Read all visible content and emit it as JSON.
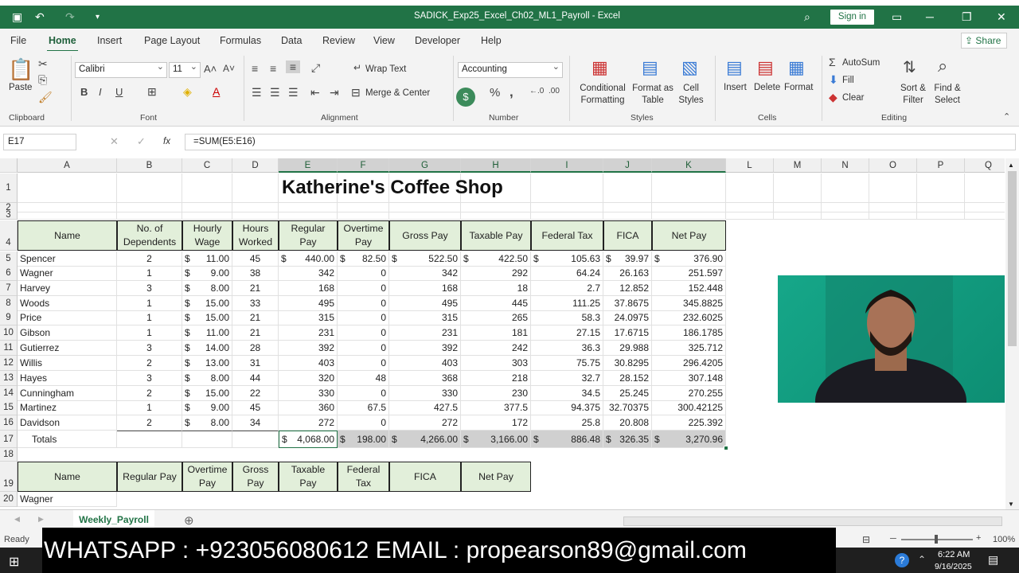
{
  "window": {
    "title": "SADICK_Exp25_Excel_Ch02_ML1_Payroll - Excel",
    "sign_in": "Sign in"
  },
  "menu": {
    "tabs": [
      "File",
      "Home",
      "Insert",
      "Page Layout",
      "Formulas",
      "Data",
      "Review",
      "View",
      "Developer",
      "Help"
    ],
    "share": "Share"
  },
  "ribbon": {
    "clipboard": {
      "paste": "Paste",
      "label": "Clipboard"
    },
    "font": {
      "name": "Calibri",
      "size": "11",
      "label": "Font"
    },
    "alignment": {
      "wrap": "Wrap Text",
      "merge": "Merge & Center",
      "label": "Alignment"
    },
    "number": {
      "format": "Accounting",
      "percent": "%",
      "comma": ",",
      "label": "Number"
    },
    "styles": {
      "cond": "Conditional Formatting",
      "table": "Format as Table",
      "cell": "Cell Styles",
      "label": "Styles"
    },
    "cells": {
      "insert": "Insert",
      "delete": "Delete",
      "format": "Format",
      "label": "Cells"
    },
    "editing": {
      "autosum": "AutoSum",
      "fill": "Fill",
      "clear": "Clear",
      "sort": "Sort & Filter",
      "find": "Find & Select",
      "label": "Editing"
    }
  },
  "formula_bar": {
    "name_box": "E17",
    "fx": "fx",
    "formula": "=SUM(E5:E16)"
  },
  "columns": [
    "A",
    "B",
    "C",
    "D",
    "E",
    "F",
    "G",
    "H",
    "I",
    "J",
    "K",
    "L",
    "M",
    "N",
    "O",
    "P",
    "Q"
  ],
  "rows": [
    "1",
    "2",
    "3",
    "4",
    "5",
    "6",
    "7",
    "8",
    "9",
    "10",
    "11",
    "12",
    "13",
    "14",
    "15",
    "16",
    "17",
    "18",
    "19",
    "20"
  ],
  "sheet_title": "Katherine's Coffee Shop",
  "headers": [
    "Name",
    "No. of Dependents",
    "Hourly Wage",
    "Hours Worked",
    "Regular Pay",
    "Overtime Pay",
    "Gross Pay",
    "Taxable Pay",
    "Federal Tax",
    "FICA",
    "Net Pay"
  ],
  "employees": [
    [
      "Spencer",
      "2",
      "11.00",
      "45",
      "440.00",
      "82.50",
      "522.50",
      "422.50",
      "105.63",
      "39.97",
      "376.90"
    ],
    [
      "Wagner",
      "1",
      "9.00",
      "38",
      "342",
      "0",
      "342",
      "292",
      "64.24",
      "26.163",
      "251.597"
    ],
    [
      "Harvey",
      "3",
      "8.00",
      "21",
      "168",
      "0",
      "168",
      "18",
      "2.7",
      "12.852",
      "152.448"
    ],
    [
      "Woods",
      "1",
      "15.00",
      "33",
      "495",
      "0",
      "495",
      "445",
      "111.25",
      "37.8675",
      "345.8825"
    ],
    [
      "Price",
      "1",
      "15.00",
      "21",
      "315",
      "0",
      "315",
      "265",
      "58.3",
      "24.0975",
      "232.6025"
    ],
    [
      "Gibson",
      "1",
      "11.00",
      "21",
      "231",
      "0",
      "231",
      "181",
      "27.15",
      "17.6715",
      "186.1785"
    ],
    [
      "Gutierrez",
      "3",
      "14.00",
      "28",
      "392",
      "0",
      "392",
      "242",
      "36.3",
      "29.988",
      "325.712"
    ],
    [
      "Willis",
      "2",
      "13.00",
      "31",
      "403",
      "0",
      "403",
      "303",
      "75.75",
      "30.8295",
      "296.4205"
    ],
    [
      "Hayes",
      "3",
      "8.00",
      "44",
      "320",
      "48",
      "368",
      "218",
      "32.7",
      "28.152",
      "307.148"
    ],
    [
      "Cunningham",
      "2",
      "15.00",
      "22",
      "330",
      "0",
      "330",
      "230",
      "34.5",
      "25.245",
      "270.255"
    ],
    [
      "Martinez",
      "1",
      "9.00",
      "45",
      "360",
      "67.5",
      "427.5",
      "377.5",
      "94.375",
      "32.70375",
      "300.42125"
    ],
    [
      "Davidson",
      "2",
      "8.00",
      "34",
      "272",
      "0",
      "272",
      "172",
      "25.8",
      "20.808",
      "225.392"
    ]
  ],
  "totals": {
    "label": "Totals",
    "values": [
      "4,068.00",
      "198.00",
      "4,266.00",
      "3,166.00",
      "886.48",
      "326.35",
      "3,270.96"
    ]
  },
  "currency": "$",
  "lookup_headers": [
    "Name",
    "Regular Pay",
    "Overtime Pay",
    "Gross Pay",
    "Taxable Pay",
    "Federal Tax",
    "FICA",
    "Net Pay"
  ],
  "lookup_name": "Wagner",
  "sheet_tab": "Weekly_Payroll",
  "status": {
    "ready": "Ready",
    "zoom": "100%"
  },
  "taskbar": {
    "time": "6:22 AM",
    "date": "9/16/2025"
  },
  "banner": "WHATSAPP : +923056080612 EMAIL : propearson89@gmail.com",
  "colors": {
    "excel_green": "#217346",
    "header_fill": "#e2efda",
    "total_fill": "#d0d0d0"
  }
}
